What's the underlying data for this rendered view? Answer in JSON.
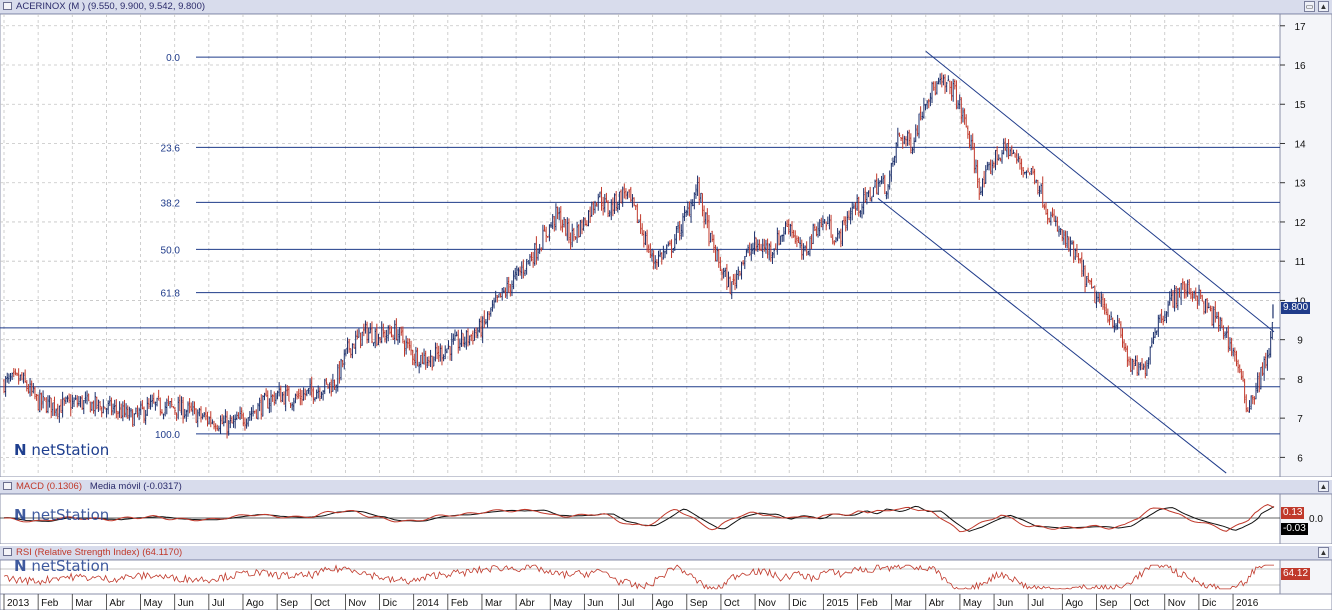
{
  "main_pane": {
    "title": "ACERINOX (M ) (9.550, 9.900, 9.542, 9.800)",
    "last_price_label": "9.800",
    "y_ticks": [
      "17",
      "16",
      "15",
      "14",
      "13",
      "12",
      "11",
      "10",
      "9",
      "8",
      "7",
      "6"
    ],
    "logo": "netStation"
  },
  "macd_pane": {
    "title_main": "MACD (0.1306)",
    "title_signal": "Media móvil (-0.0317)",
    "value_tag": "0.13",
    "signal_tag": "-0.03",
    "zero_tick": "0.0",
    "logo": "netStation"
  },
  "rsi_pane": {
    "title": "RSI (Relative Strength Index) (64.1170)",
    "value_tag": "64.12",
    "logo": "netStation"
  },
  "x_axis_labels": [
    "2013",
    "Feb",
    "Mar",
    "Abr",
    "May",
    "Jun",
    "Jul",
    "Ago",
    "Sep",
    "Oct",
    "Nov",
    "Dic",
    "2014",
    "Feb",
    "Mar",
    "Abr",
    "May",
    "Jun",
    "Jul",
    "Ago",
    "Sep",
    "Oct",
    "Nov",
    "Dic",
    "2015",
    "Feb",
    "Mar",
    "Abr",
    "May",
    "Jun",
    "Jul",
    "Ago",
    "Sep",
    "Oct",
    "Nov",
    "Dic",
    "2016"
  ],
  "chart_data": [
    {
      "type": "candlestick",
      "title": "ACERINOX (M ) (9.550, 9.900, 9.542, 9.800)",
      "ylim": [
        5.5,
        17.3
      ],
      "y_ticks": [
        6,
        7,
        8,
        9,
        10,
        11,
        12,
        13,
        14,
        15,
        16,
        17
      ],
      "grid": true,
      "last": {
        "open": 9.55,
        "high": 9.9,
        "low": 9.542,
        "close": 9.8
      },
      "x_range": [
        0,
        37.2
      ],
      "price_path": [
        [
          0,
          7.9
        ],
        [
          0.5,
          8.0
        ],
        [
          1.0,
          7.4
        ],
        [
          1.6,
          7.3
        ],
        [
          2.2,
          7.4
        ],
        [
          2.8,
          7.3
        ],
        [
          3.3,
          7.2
        ],
        [
          3.8,
          7.0
        ],
        [
          4.3,
          7.3
        ],
        [
          4.8,
          7.3
        ],
        [
          5.3,
          7.2
        ],
        [
          5.9,
          7.0
        ],
        [
          6.3,
          6.9
        ],
        [
          6.6,
          6.8
        ],
        [
          7.0,
          7.0
        ],
        [
          7.5,
          7.3
        ],
        [
          8.0,
          7.6
        ],
        [
          8.5,
          7.5
        ],
        [
          9.1,
          7.7
        ],
        [
          9.7,
          7.9
        ],
        [
          10.1,
          8.8
        ],
        [
          10.6,
          9.2
        ],
        [
          11.0,
          9.1
        ],
        [
          11.5,
          9.2
        ],
        [
          12.0,
          8.6
        ],
        [
          12.5,
          8.5
        ],
        [
          13.0,
          8.8
        ],
        [
          13.5,
          9.0
        ],
        [
          14.0,
          9.3
        ],
        [
          14.4,
          9.9
        ],
        [
          15.0,
          10.6
        ],
        [
          15.6,
          11.3
        ],
        [
          16.2,
          12.2
        ],
        [
          16.6,
          11.6
        ],
        [
          17.0,
          12.0
        ],
        [
          17.4,
          12.7
        ],
        [
          17.7,
          12.3
        ],
        [
          18.2,
          12.8
        ],
        [
          18.6,
          12.0
        ],
        [
          19.0,
          11.0
        ],
        [
          19.5,
          11.3
        ],
        [
          20.0,
          12.2
        ],
        [
          20.3,
          12.9
        ],
        [
          20.7,
          11.5
        ],
        [
          21.0,
          10.8
        ],
        [
          21.3,
          10.3
        ],
        [
          21.6,
          11.0
        ],
        [
          22.0,
          11.4
        ],
        [
          22.5,
          11.3
        ],
        [
          23.0,
          12.0
        ],
        [
          23.4,
          11.1
        ],
        [
          23.8,
          11.9
        ],
        [
          24.1,
          12.0
        ],
        [
          24.4,
          11.5
        ],
        [
          24.8,
          12.3
        ],
        [
          25.2,
          12.5
        ],
        [
          25.6,
          13.0
        ],
        [
          25.9,
          12.9
        ],
        [
          26.2,
          14.2
        ],
        [
          26.6,
          14.0
        ],
        [
          27.0,
          15.2
        ],
        [
          27.4,
          15.5
        ],
        [
          27.8,
          15.4
        ],
        [
          28.2,
          14.4
        ],
        [
          28.6,
          12.8
        ],
        [
          29.0,
          13.6
        ],
        [
          29.4,
          13.9
        ],
        [
          29.8,
          13.4
        ],
        [
          30.2,
          13.2
        ],
        [
          30.6,
          12.2
        ],
        [
          31.0,
          11.6
        ],
        [
          31.4,
          11.1
        ],
        [
          31.8,
          10.3
        ],
        [
          32.2,
          9.8
        ],
        [
          32.6,
          9.4
        ],
        [
          33.0,
          8.3
        ],
        [
          33.4,
          8.2
        ],
        [
          33.7,
          9.3
        ],
        [
          34.1,
          9.9
        ],
        [
          34.5,
          10.3
        ],
        [
          34.9,
          10.2
        ],
        [
          35.3,
          9.7
        ],
        [
          35.7,
          9.3
        ],
        [
          36.1,
          8.5
        ],
        [
          36.4,
          7.3
        ],
        [
          36.6,
          7.6
        ],
        [
          36.9,
          8.3
        ],
        [
          37.1,
          8.9
        ],
        [
          37.2,
          9.8
        ]
      ],
      "fibonacci_levels": [
        {
          "label": "0.0",
          "price": 16.2
        },
        {
          "label": "23.6",
          "price": 13.9
        },
        {
          "label": "38.2",
          "price": 12.5
        },
        {
          "label": "50.0",
          "price": 11.3
        },
        {
          "label": "61.8",
          "price": 10.2
        },
        {
          "label": "100.0",
          "price": 6.6
        }
      ],
      "support_resistance_lines": [
        9.3,
        7.8
      ],
      "trend_channel": {
        "upper": [
          [
            27.0,
            16.35
          ],
          [
            37.2,
            9.2
          ]
        ],
        "lower": [
          [
            25.6,
            12.6
          ],
          [
            35.8,
            5.6
          ]
        ]
      }
    },
    {
      "type": "line",
      "title": "MACD (0.1306) / Media móvil (-0.0317)",
      "series": [
        {
          "name": "MACD",
          "color": "#c0392b"
        },
        {
          "name": "Media móvil",
          "color": "#111111"
        }
      ],
      "y_ticks": [
        0.0
      ],
      "last_values": {
        "MACD": 0.13,
        "Media móvil": -0.03
      }
    },
    {
      "type": "line",
      "title": "RSI (Relative Strength Index) (64.1170)",
      "series": [
        {
          "name": "RSI",
          "color": "#c0392b"
        }
      ],
      "last_value": 64.12
    }
  ]
}
